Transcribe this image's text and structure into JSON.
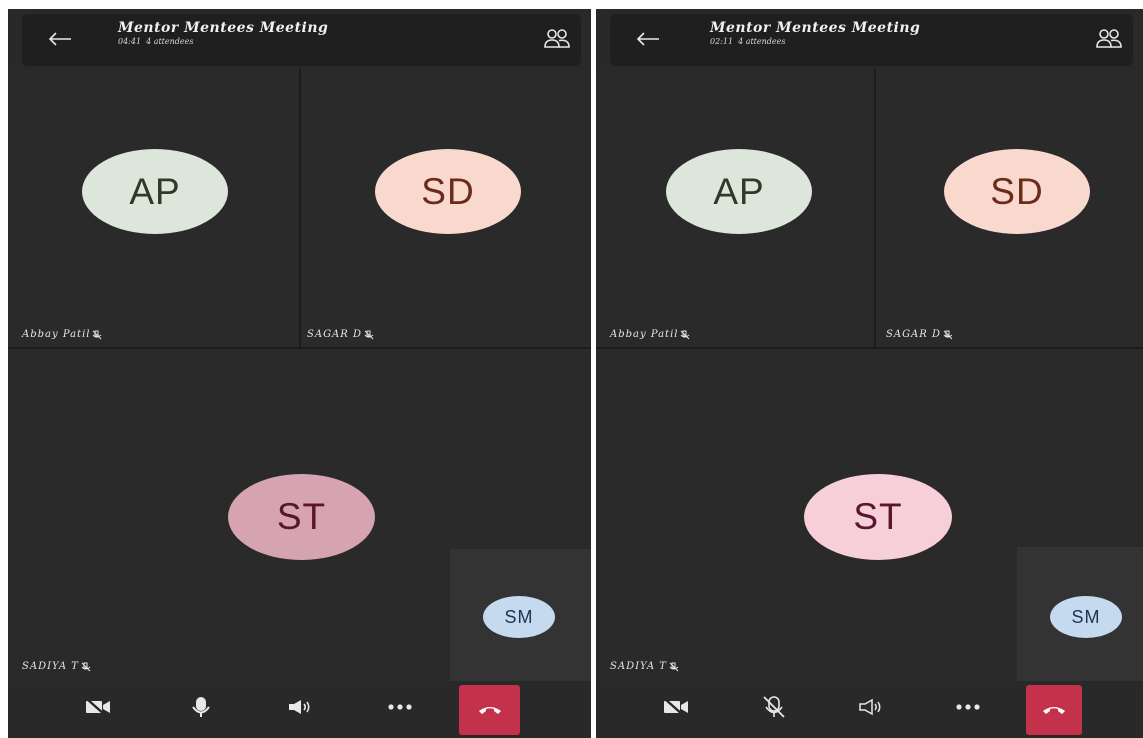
{
  "screens": [
    {
      "header": {
        "title": "Mentor Mentees Meeting",
        "duration": "04:41",
        "attendees": "4 attendees"
      },
      "participants": [
        {
          "initials": "AP",
          "name": "Abbay Patil"
        },
        {
          "initials": "SD",
          "name": "SAGAR D"
        },
        {
          "initials": "ST",
          "name": "SADIYA T"
        },
        {
          "initials": "SM",
          "name": ""
        }
      ],
      "controls": {
        "camera": "off",
        "microphone": "on",
        "speaker": "on"
      }
    },
    {
      "header": {
        "title": "Mentor Mentees Meeting",
        "duration": "02:11",
        "attendees": "4 attendees"
      },
      "participants": [
        {
          "initials": "AP",
          "name": "Abbay Patil"
        },
        {
          "initials": "SD",
          "name": "SAGAR D"
        },
        {
          "initials": "ST",
          "name": "SADIYA T"
        },
        {
          "initials": "SM",
          "name": ""
        }
      ],
      "controls": {
        "camera": "off",
        "microphone": "off",
        "speaker": "off"
      }
    }
  ],
  "icons": {
    "back": "back-arrow-icon",
    "people": "people-icon",
    "camera_off": "camera-off-icon",
    "mic": "microphone-icon",
    "mic_off": "microphone-off-icon",
    "speaker_on": "speaker-on-icon",
    "speaker_outline": "speaker-outline-icon",
    "more": "more-options-icon",
    "end_call": "end-call-icon"
  },
  "colors": {
    "background": "#292929",
    "header": "#1f1f1f",
    "end_call": "#c4314b",
    "avatar_ap": "#dde6da",
    "avatar_sd": "#f9d8cd",
    "avatar_st_left": "#d6a4b0",
    "avatar_st_right": "#f6cfd8",
    "avatar_sm": "#c5d9ef"
  }
}
